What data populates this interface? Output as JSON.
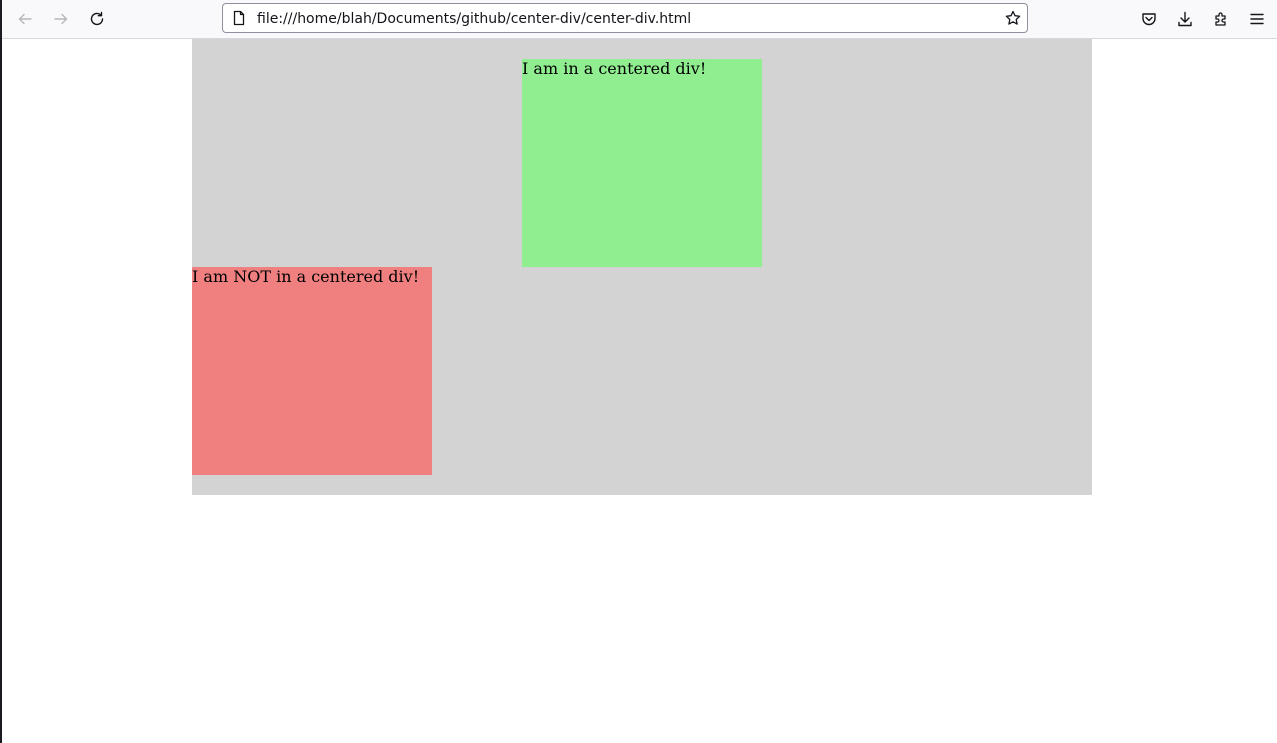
{
  "browser": {
    "url": "file:///home/blah/Documents/github/center-div/center-div.html",
    "nav_icons": [
      "back-arrow-icon",
      "forward-arrow-icon",
      "reload-icon"
    ],
    "toolbar_icons": [
      "pocket-icon",
      "download-icon",
      "extensions-icon",
      "menu-icon"
    ]
  },
  "page": {
    "container_color": "#d3d3d3",
    "centered_box": {
      "text": "I am in a centered div!",
      "color": "#90ee90"
    },
    "uncentered_box": {
      "text": "I am NOT in a centered div!",
      "color": "#f08080"
    }
  }
}
